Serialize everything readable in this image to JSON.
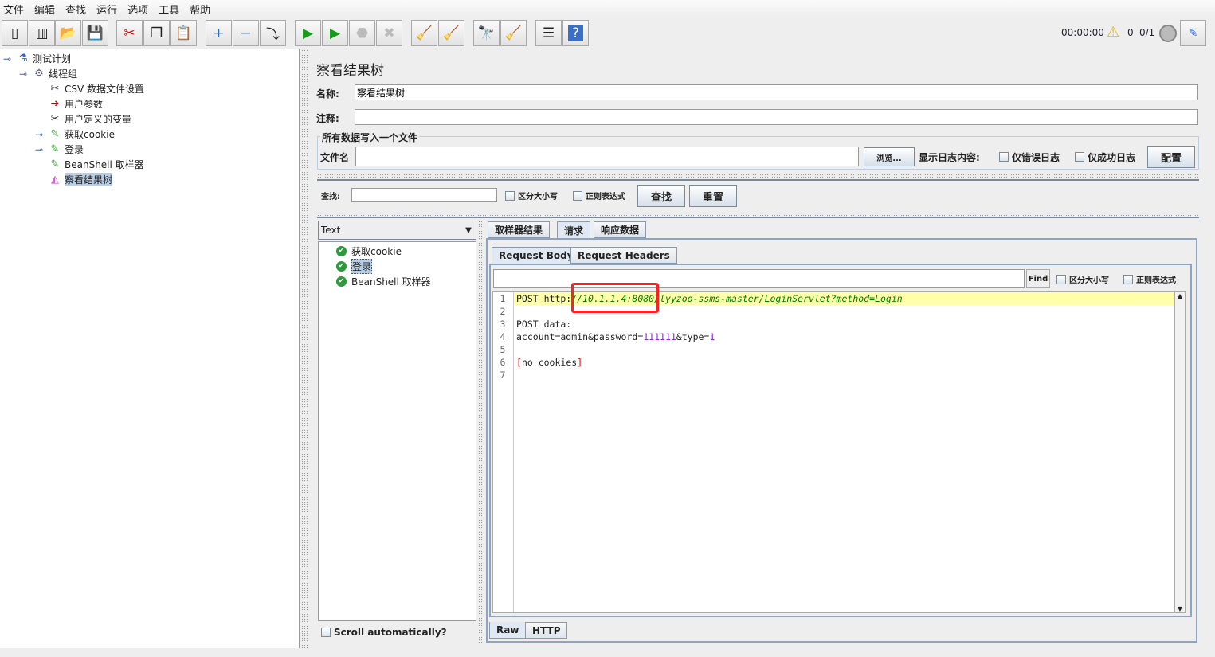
{
  "menu": [
    "文件",
    "编辑",
    "查找",
    "运行",
    "选项",
    "工具",
    "帮助"
  ],
  "toolbar": {
    "icons": [
      "new-icon",
      "templates-icon",
      "open-icon",
      "save-icon",
      "cut-icon",
      "copy-icon",
      "paste-icon",
      "expand-icon",
      "collapse-icon",
      "toggle-icon",
      "start-icon",
      "start-no-pause-icon",
      "stop-icon",
      "shutdown-icon",
      "clear-icon",
      "clear-all-icon",
      "search-icon",
      "reset-search-icon",
      "function-helper-icon",
      "help-icon"
    ],
    "timer": "00:00:00",
    "warnings": "0",
    "threads": "0/1"
  },
  "tree": {
    "items": [
      {
        "label": "测试计划",
        "icon": "test-plan-icon"
      },
      {
        "label": "线程组",
        "icon": "thread-group-icon"
      },
      {
        "label": "CSV 数据文件设置",
        "icon": "config-icon"
      },
      {
        "label": "用户参数",
        "icon": "preprocessor-icon"
      },
      {
        "label": "用户定义的变量",
        "icon": "config-icon"
      },
      {
        "label": "获取cookie",
        "icon": "sampler-icon"
      },
      {
        "label": "登录",
        "icon": "sampler-icon"
      },
      {
        "label": "BeanShell 取样器",
        "icon": "sampler-icon"
      },
      {
        "label": "察看结果树",
        "icon": "listener-icon",
        "selected": true
      }
    ]
  },
  "main": {
    "title": "察看结果树",
    "name_label": "名称:",
    "name_value": "察看结果树",
    "comment_label": "注释:",
    "comment_value": "",
    "file_group": "所有数据写入一个文件",
    "file_label": "文件名",
    "file_value": "",
    "browse": "浏览...",
    "log_label": "显示日志内容:",
    "errors_only": "仅错误日志",
    "success_only": "仅成功日志",
    "configure": "配置",
    "search_label": "查找:",
    "search_value": "",
    "case_sensitive": "区分大小写",
    "regex": "正则表达式",
    "search_btn": "查找",
    "reset_btn": "重置"
  },
  "results": {
    "renderer": "Text",
    "samples": [
      {
        "label": "获取cookie",
        "status": "success"
      },
      {
        "label": "登录",
        "status": "success",
        "selected": true
      },
      {
        "label": "BeanShell 取样器",
        "status": "success"
      }
    ],
    "scroll_auto": "Scroll automatically?",
    "tabs": [
      "取样器结果",
      "请求",
      "响应数据"
    ],
    "active_tab": "请求",
    "subtabs": [
      "Request Body",
      "Request Headers"
    ],
    "active_subtab": "Request Body",
    "find": "Find",
    "find_case": "区分大小写",
    "find_regex": "正则表达式",
    "lines": [
      "1",
      "2",
      "3",
      "4",
      "5",
      "6",
      "7"
    ],
    "code": {
      "l1_a": "POST http:",
      "l1_b": "//10.1.1.4:8080/lyyzoo-ssms-master/LoginServlet?method=Login",
      "l3": "POST data:",
      "l4_a": "account=admin&password=",
      "l4_b": "111111",
      "l4_c": "&type=",
      "l4_d": "1",
      "l6_a": "[",
      "l6_b": "no cookies",
      "l6_c": "]"
    },
    "bottom_tabs": [
      "Raw",
      "HTTP"
    ],
    "active_bottom": "Raw"
  },
  "colors": {
    "highlight": "#ffffaa",
    "url": "#008000",
    "number": "#8a2be2",
    "annotation": "#ff0000"
  }
}
